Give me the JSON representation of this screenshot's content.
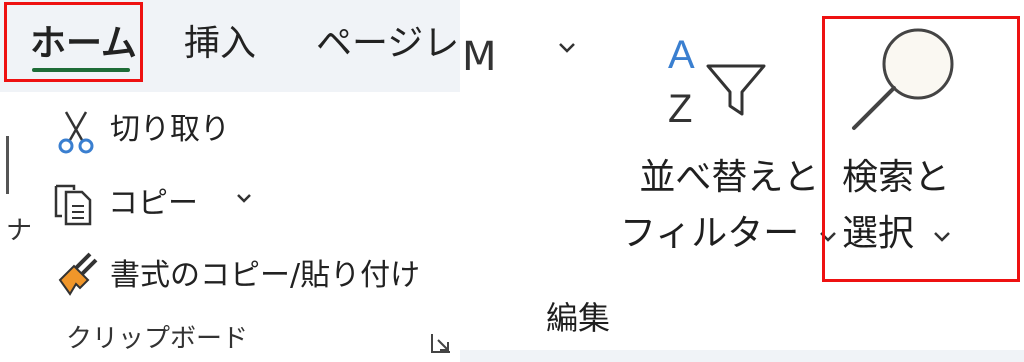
{
  "tabs": {
    "home": "ホーム",
    "insert": "挿入",
    "page": "ページレ"
  },
  "clipboard": {
    "cut": "切り取り",
    "copy": "コピー",
    "format_painter": "書式のコピー/貼り付け",
    "group_label": "クリップボード",
    "edge_glyph": "ナ"
  },
  "editing": {
    "partial_glyph": "M",
    "sort_filter_line1": "並べ替えと",
    "sort_filter_line2": "フィルター",
    "find_select_line1": "検索と",
    "find_select_line2": "選択",
    "group_label": "編集"
  },
  "icons": {
    "cut": "scissors-icon",
    "copy": "copy-icon",
    "format_painter": "paintbrush-icon",
    "sort_filter": "sort-az-filter-icon",
    "find": "magnifier-icon",
    "dropdown": "chevron-down-icon",
    "launcher": "dialog-launcher-icon"
  },
  "colors": {
    "highlight": "#ee1111",
    "active_tab_underline": "#1e6c37",
    "tab_strip_bg": "#f0f3f7",
    "accent_blue": "#3a7fd0",
    "painter_orange": "#f0962a"
  }
}
